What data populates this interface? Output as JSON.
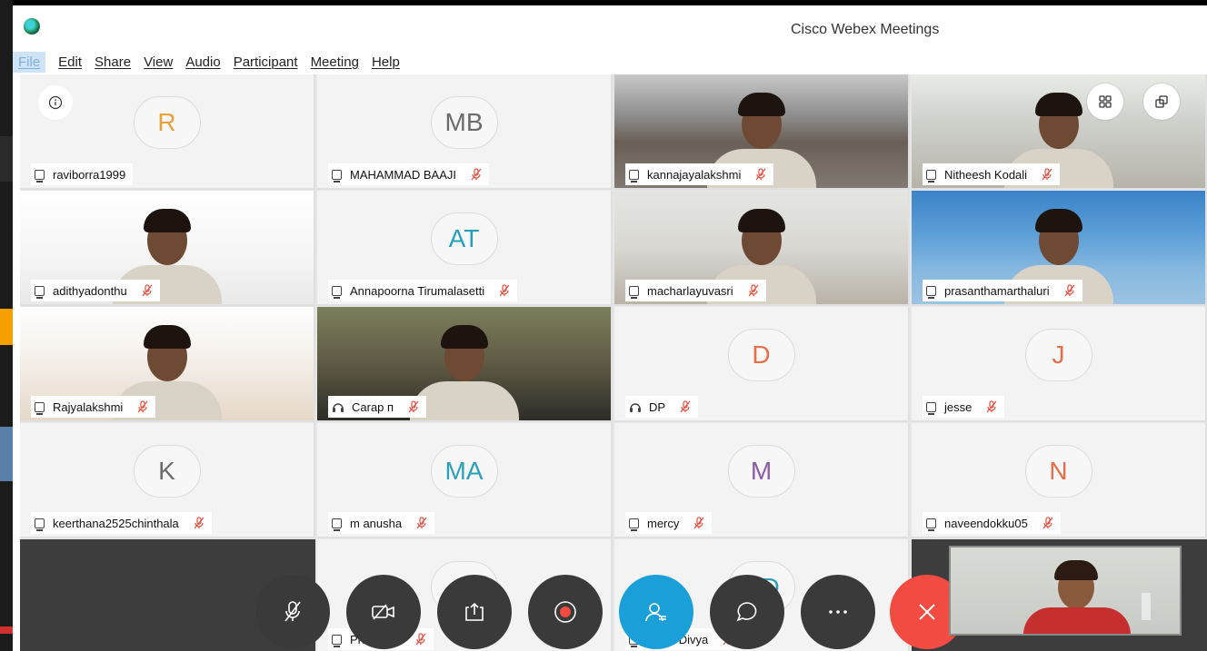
{
  "window": {
    "title": "Cisco Webex Meetings"
  },
  "menu": [
    "File",
    "Edit",
    "Share",
    "View",
    "Audio",
    "Participant",
    "Meeting",
    "Help"
  ],
  "colors": {
    "avatar_orange": "#e8a23b",
    "avatar_gray": "#6b6b6b",
    "avatar_teal": "#2a9fb8",
    "avatar_purple": "#8d5aa8",
    "avatar_salmon": "#e86d4a",
    "accent_blue": "#1a9fd8",
    "end_red": "#f24b41"
  },
  "participants": [
    {
      "name": "raviborra1999",
      "initials": "R",
      "muted": false,
      "device": "computer",
      "video": false,
      "color": "#e8a23b"
    },
    {
      "name": "MAHAMMAD BAAJI",
      "initials": "MB",
      "muted": true,
      "device": "computer",
      "video": false,
      "color": "#6b6b6b"
    },
    {
      "name": "kannajayalakshmi",
      "initials": "",
      "muted": true,
      "device": "computer",
      "video": true
    },
    {
      "name": "Nitheesh Kodali",
      "initials": "",
      "muted": true,
      "device": "computer",
      "video": true
    },
    {
      "name": "adithyadonthu",
      "initials": "",
      "muted": true,
      "device": "computer",
      "video": true
    },
    {
      "name": "Annapoorna Tirumalasetti",
      "initials": "AT",
      "muted": true,
      "device": "computer",
      "video": false,
      "color": "#2a9fb8"
    },
    {
      "name": "macharlayuvasri",
      "initials": "",
      "muted": true,
      "device": "computer",
      "video": true
    },
    {
      "name": "prasanthamarthaluri",
      "initials": "",
      "muted": true,
      "device": "computer",
      "video": true
    },
    {
      "name": "Rajyalakshmi",
      "initials": "",
      "muted": true,
      "device": "computer",
      "video": true
    },
    {
      "name": "Carap п",
      "initials": "",
      "muted": true,
      "device": "phone",
      "video": true
    },
    {
      "name": "DP",
      "initials": "D",
      "muted": true,
      "device": "phone",
      "video": false,
      "color": "#e86d4a"
    },
    {
      "name": "jesse",
      "initials": "J",
      "muted": true,
      "device": "computer",
      "video": false,
      "color": "#e86d4a"
    },
    {
      "name": "keerthana2525chinthala",
      "initials": "K",
      "muted": true,
      "device": "computer",
      "video": false,
      "color": "#6b6b6b"
    },
    {
      "name": "m anusha",
      "initials": "MA",
      "muted": true,
      "device": "computer",
      "video": false,
      "color": "#2a9fb8"
    },
    {
      "name": "mercy",
      "initials": "M",
      "muted": true,
      "device": "computer",
      "video": false,
      "color": "#8d5aa8"
    },
    {
      "name": "naveendokku05",
      "initials": "N",
      "muted": true,
      "device": "computer",
      "video": false,
      "color": "#e86d4a"
    },
    {
      "name": "Prasanna",
      "initials": "P",
      "muted": true,
      "device": "computer",
      "video": false,
      "color": "#2a9fb8"
    },
    {
      "name": "Rupa Divya",
      "initials": "RD",
      "muted": true,
      "device": "computer",
      "video": false,
      "color": "#2a9fb8"
    }
  ],
  "controls": [
    {
      "name": "mute-button",
      "icon": "mic-muted-icon"
    },
    {
      "name": "video-button",
      "icon": "video-off-icon"
    },
    {
      "name": "share-button",
      "icon": "share-icon"
    },
    {
      "name": "record-button",
      "icon": "record-icon"
    },
    {
      "name": "participants-button",
      "icon": "participants-icon"
    },
    {
      "name": "chat-button",
      "icon": "chat-icon"
    },
    {
      "name": "more-button",
      "icon": "more-icon"
    },
    {
      "name": "end-meeting-button",
      "icon": "close-icon"
    }
  ]
}
